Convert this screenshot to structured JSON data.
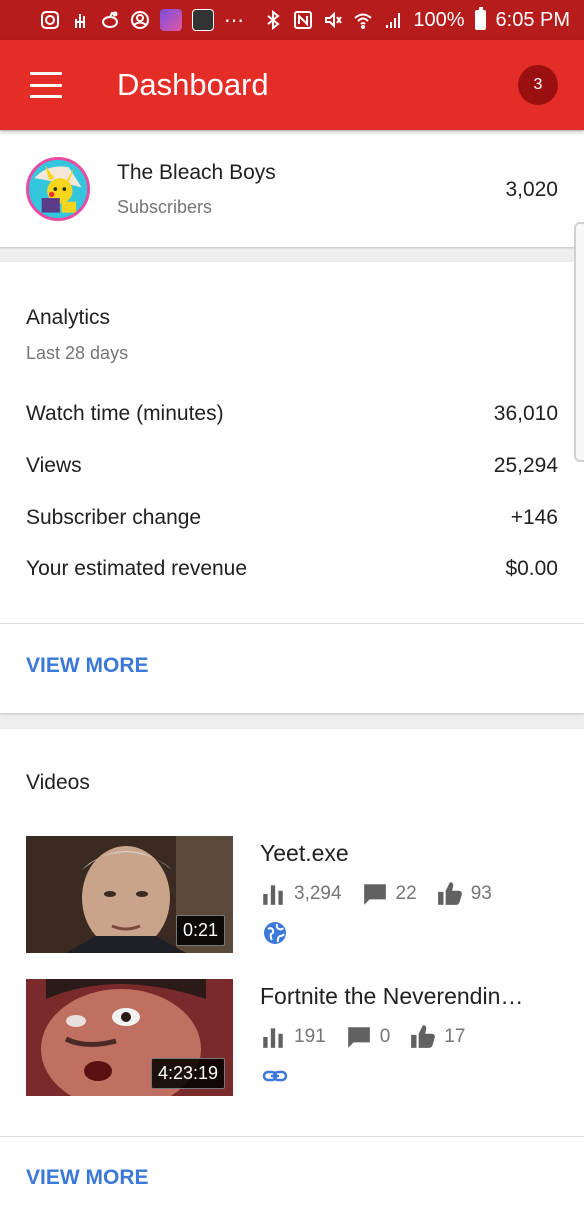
{
  "status_bar": {
    "battery": "100%",
    "time": "6:05 PM",
    "overflow": "⋯"
  },
  "app_bar": {
    "title": "Dashboard",
    "notification_count": "3"
  },
  "channel": {
    "name": "The Bleach Boys",
    "subscribers_label": "Subscribers",
    "subscribers_count": "3,020"
  },
  "analytics": {
    "title": "Analytics",
    "period": "Last 28 days",
    "metrics": [
      {
        "label": "Watch time (minutes)",
        "value": "36,010"
      },
      {
        "label": "Views",
        "value": "25,294"
      },
      {
        "label": "Subscriber change",
        "value": "+146"
      },
      {
        "label": "Your estimated revenue",
        "value": "$0.00"
      }
    ],
    "view_more": "VIEW MORE"
  },
  "videos": {
    "title": "Videos",
    "items": [
      {
        "title": "Yeet.exe",
        "duration": "0:21",
        "views": "3,294",
        "comments": "22",
        "likes": "93",
        "visibility": "public-globe-icon"
      },
      {
        "title": "Fortnite the Neverendin…",
        "duration": "4:23:19",
        "views": "191",
        "comments": "0",
        "likes": "17",
        "visibility": "unlisted-link-icon"
      }
    ],
    "view_more": "VIEW MORE"
  },
  "colors": {
    "status_bar": "#b71c1c",
    "app_bar": "#e52d27",
    "badge": "#9a1010",
    "link": "#3c78d8"
  }
}
